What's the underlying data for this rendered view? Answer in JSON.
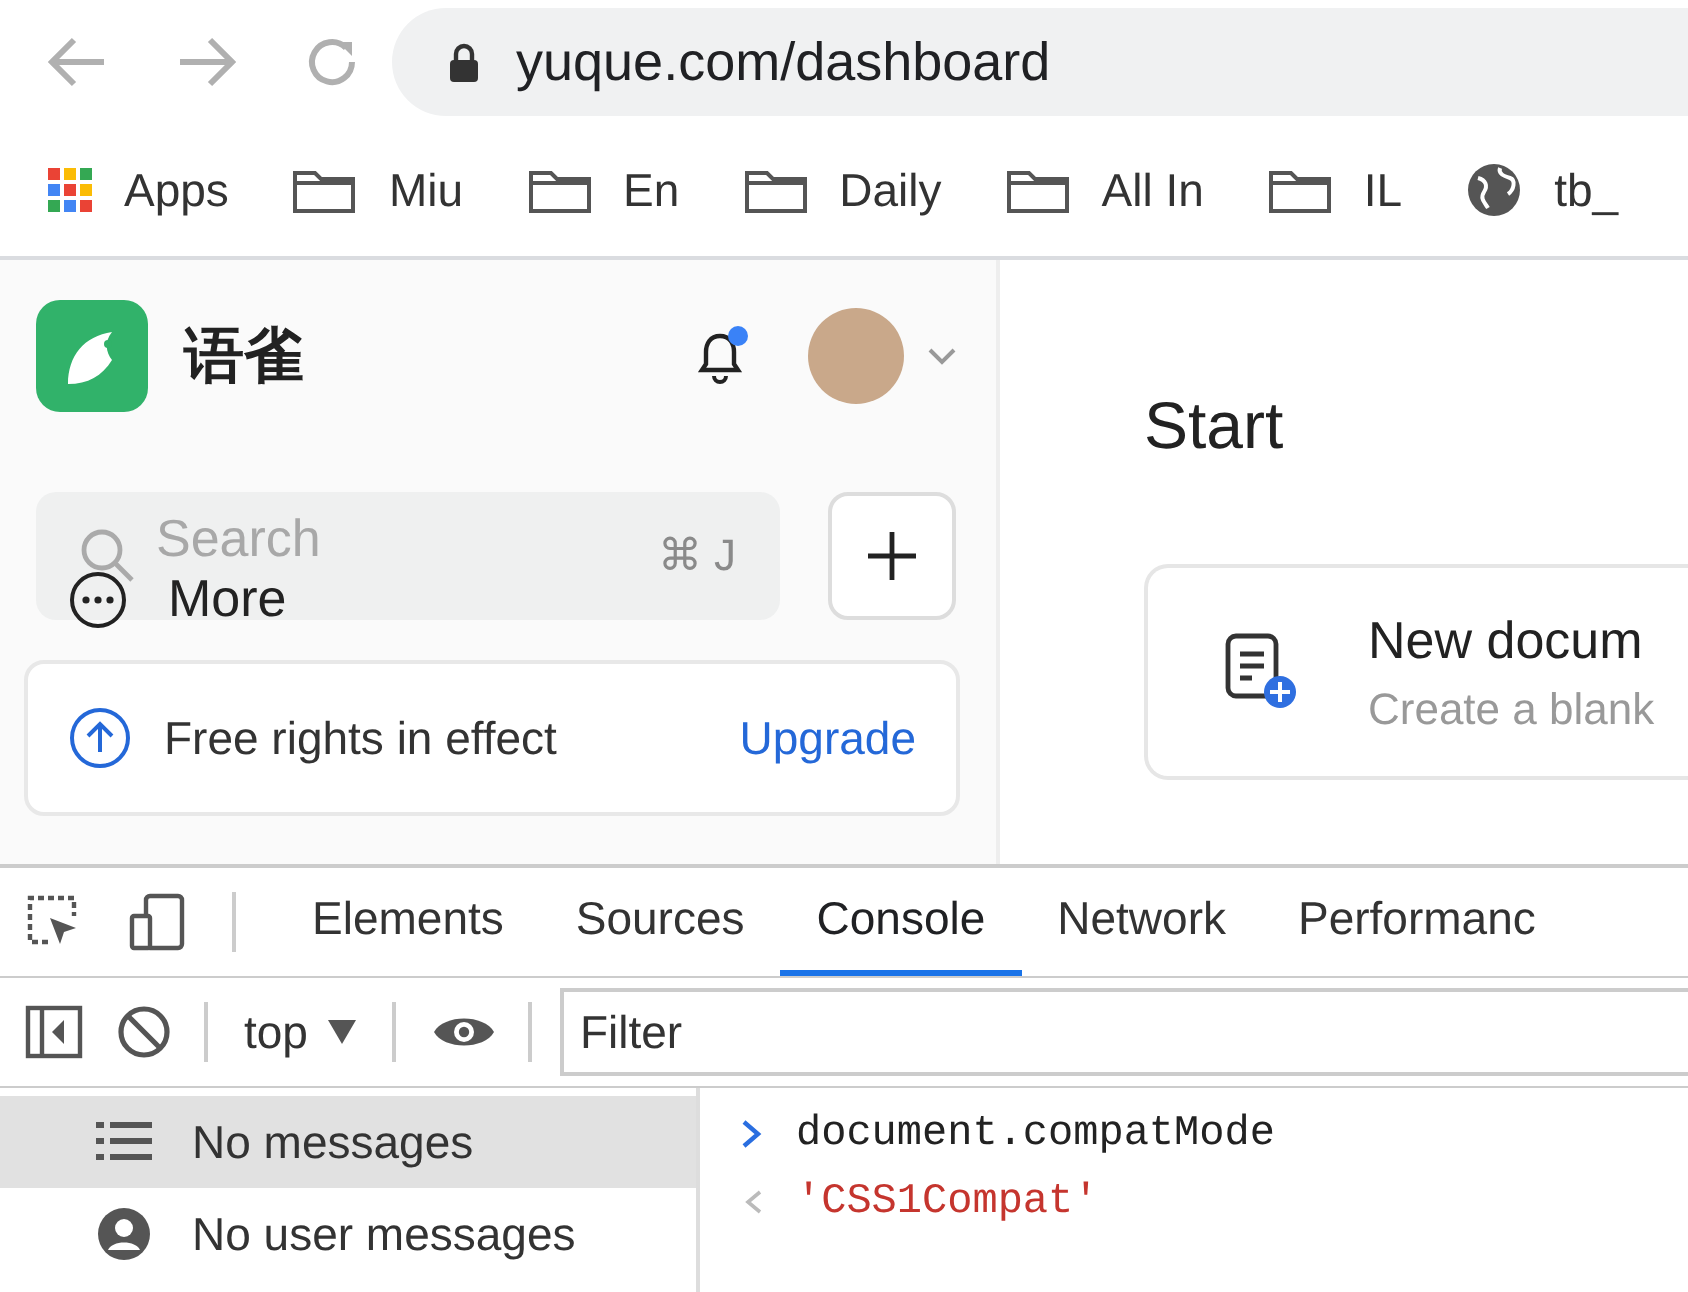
{
  "browser": {
    "address": {
      "url": "yuque.com/dashboard"
    },
    "bookmarks": [
      {
        "label": "Apps",
        "kind": "apps"
      },
      {
        "label": "Miu",
        "kind": "folder"
      },
      {
        "label": "En",
        "kind": "folder"
      },
      {
        "label": "Daily",
        "kind": "folder"
      },
      {
        "label": "All In",
        "kind": "folder"
      },
      {
        "label": "IL",
        "kind": "folder"
      },
      {
        "label": "tb_",
        "kind": "site"
      }
    ]
  },
  "sidebar": {
    "brand": "语雀",
    "notification": {
      "unread": true
    },
    "search": {
      "placeholder": "Search",
      "shortcut": "⌘ J"
    },
    "more": "More",
    "rights": {
      "text": "Free rights in effect",
      "action": "Upgrade"
    }
  },
  "main": {
    "heading": "Start",
    "cards": [
      {
        "title": "New docum",
        "subtitle": "Create a blank"
      }
    ]
  },
  "devtools": {
    "tabs": [
      {
        "label": "Elements",
        "selected": false
      },
      {
        "label": "Sources",
        "selected": false
      },
      {
        "label": "Console",
        "selected": true
      },
      {
        "label": "Network",
        "selected": false
      },
      {
        "label": "Performanc",
        "selected": false
      }
    ],
    "context": "top",
    "filter": {
      "placeholder": "Filter"
    },
    "sidebar": [
      {
        "label": "No messages",
        "kind": "all",
        "selected": true
      },
      {
        "label": "No user messages",
        "kind": "user",
        "selected": false
      }
    ],
    "console": [
      {
        "kind": "input",
        "text": "document.compatMode"
      },
      {
        "kind": "output",
        "text": "'CSS1Compat'"
      }
    ]
  }
}
